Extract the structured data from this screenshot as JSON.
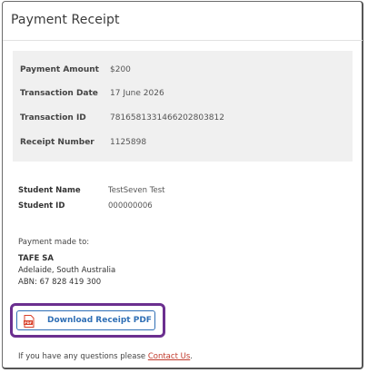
{
  "receipt": {
    "title": "Payment Receipt",
    "summary": [
      {
        "label": "Payment Amount",
        "value": "$200"
      },
      {
        "label": "Transaction Date",
        "value": "17 June 2026"
      },
      {
        "label": "Transaction ID",
        "value": "7816581331466202803812"
      },
      {
        "label": "Receipt Number",
        "value": "1125898"
      }
    ],
    "student": [
      {
        "label": "Student Name",
        "value": "TestSeven Test"
      },
      {
        "label": "Student ID",
        "value": "000000006"
      }
    ],
    "payment_made_to_label": "Payment made to:",
    "org_name": "TAFE SA",
    "org_location": "Adelaide, South Australia",
    "org_abn": "ABN: 67 828 419 300",
    "download_label": "Download Receipt PDF",
    "pdf_icon_text": "PDF",
    "footer_text": "If you have any questions please ",
    "footer_link": "Contact Us",
    "footer_end": "."
  },
  "colors": {
    "accent_blue": "#2f6fb5",
    "highlight_purple": "#6b2f8f",
    "link_red": "#c0392b",
    "pdf_red": "#d9412b"
  }
}
